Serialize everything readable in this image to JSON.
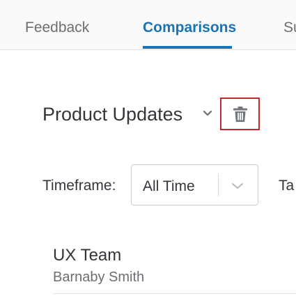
{
  "tabs": {
    "feedback": "Feedback",
    "comparisons": "Comparisons",
    "summary_partial": "Su",
    "active_color": "#1a73b5"
  },
  "dashboard": {
    "title": "Product Updates",
    "dropdown_icon": "chevron-down-icon",
    "delete_icon": "trash-icon",
    "delete_highlight_color": "#c5282f"
  },
  "filters": {
    "timeframe_label": "Timeframe:",
    "timeframe_value": "All Time",
    "timeframe_icon": "chevron-down-icon",
    "next_label_partial": "Ta"
  },
  "list": {
    "items": [
      {
        "title": "UX Team",
        "subtitle": "Barnaby Smith"
      }
    ]
  }
}
